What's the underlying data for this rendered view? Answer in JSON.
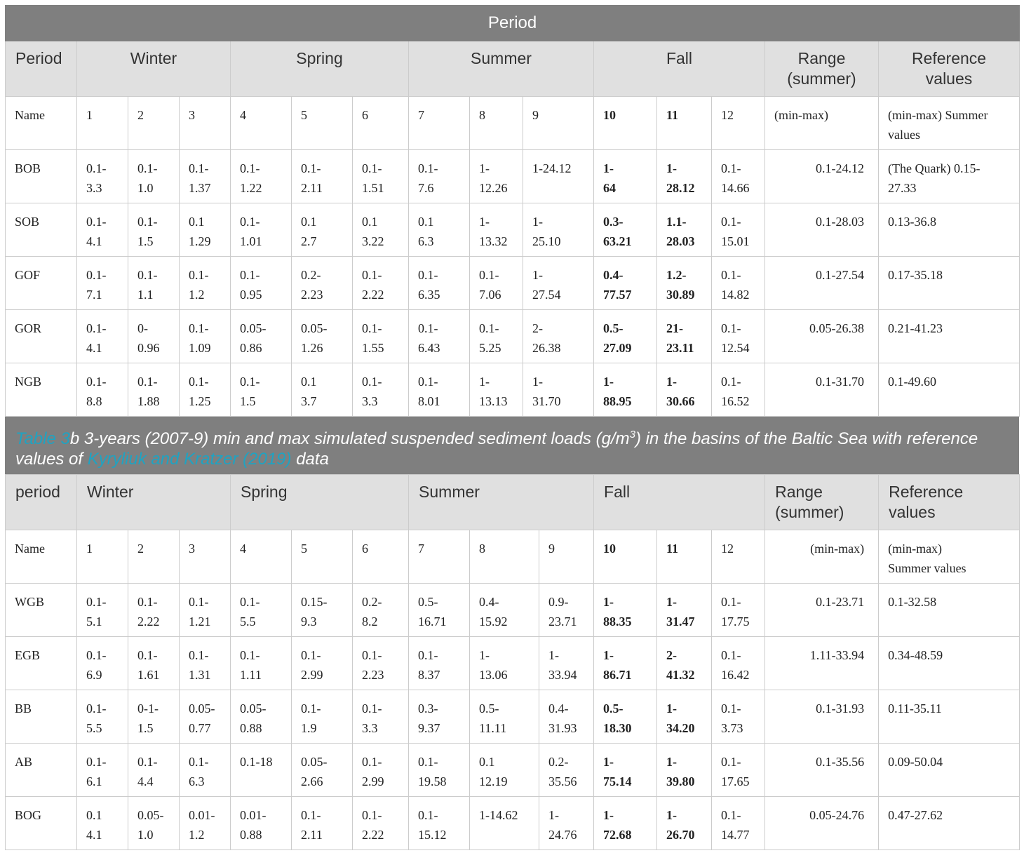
{
  "title_bar": "Period",
  "caption": {
    "part1": "Table 3",
    "part2": "b 3-years (2007-9) min and max simulated suspended sediment loads (g/m",
    "sup": "3",
    "part3": ") in the basins of the Baltic Sea with reference values of ",
    "link": "Kyryliuk and Kratzer (2019)",
    "part4": " data"
  },
  "table1": {
    "headers": [
      "Period",
      "Winter",
      "Spring",
      "Summer",
      "Fall",
      "Range\n(summer)",
      "Reference\nvalues"
    ],
    "name_row": [
      "Name",
      "1",
      "2",
      "3",
      "4",
      "5",
      "6",
      "7",
      "8",
      "9",
      "10",
      "11",
      "12",
      "(min-max)",
      "(min-max) Summer values"
    ],
    "rows": [
      [
        "BOB",
        "0.1-\n3.3",
        "0.1-\n1.0",
        "0.1-\n1.37",
        "0.1-\n1.22",
        "0.1-\n2.11",
        "0.1-\n1.51",
        "0.1-\n7.6",
        "1-\n12.26",
        "1-24.12",
        "1-\n64",
        "1-\n28.12",
        "0.1-\n14.66",
        "0.1-24.12",
        "(The Quark) 0.15-\n27.33"
      ],
      [
        "SOB",
        "0.1-\n4.1",
        "0.1-\n1.5",
        "0.1\n1.29",
        "0.1-\n1.01",
        "0.1\n2.7",
        "0.1\n3.22",
        "0.1\n6.3",
        "1-\n13.32",
        "1-\n25.10",
        "0.3-\n63.21",
        "1.1-\n28.03",
        "0.1-\n15.01",
        "0.1-28.03",
        "0.13-36.8"
      ],
      [
        "GOF",
        "0.1-\n7.1",
        "0.1-\n1.1",
        "0.1-\n1.2",
        "0.1-\n0.95",
        "0.2-\n2.23",
        "0.1-\n2.22",
        "0.1-\n6.35",
        "0.1-\n7.06",
        "1-\n27.54",
        "0.4-\n77.57",
        "1.2-\n30.89",
        "0.1-\n14.82",
        "0.1-27.54",
        "0.17-35.18"
      ],
      [
        "GOR",
        "0.1-\n4.1",
        "0-\n0.96",
        "0.1-\n1.09",
        "0.05-\n0.86",
        "0.05-\n1.26",
        "0.1-\n1.55",
        "0.1-\n6.43",
        "0.1-\n5.25",
        "2-\n26.38",
        "0.5-\n27.09",
        "21-\n23.11",
        "0.1-\n12.54",
        "0.05-26.38",
        "0.21-41.23"
      ],
      [
        "NGB",
        "0.1-\n8.8",
        "0.1-\n1.88",
        "0.1-\n1.25",
        "0.1-\n1.5",
        "0.1\n3.7",
        "0.1-\n3.3",
        "0.1-\n8.01",
        "1-\n13.13",
        "1-\n31.70",
        "1-\n88.95",
        "1-\n30.66",
        "0.1-\n16.52",
        "0.1-31.70",
        "0.1-49.60"
      ]
    ]
  },
  "table2": {
    "headers": [
      "period",
      "Winter",
      "Spring",
      "Summer",
      "Fall",
      "Range\n(summer)",
      "Reference\nvalues"
    ],
    "name_row": [
      "Name",
      "1",
      "2",
      "3",
      "4",
      "5",
      "6",
      "7",
      "8",
      "9",
      "10",
      "11",
      "12",
      "(min-max)",
      "(min-max)\nSummer values"
    ],
    "rows": [
      [
        "WGB",
        "0.1-\n5.1",
        "0.1-\n2.22",
        "0.1-\n1.21",
        "0.1-\n5.5",
        "0.15-\n9.3",
        "0.2-\n8.2",
        "0.5-\n16.71",
        "0.4-\n15.92",
        "0.9-\n23.71",
        "1-\n88.35",
        "1-\n31.47",
        "0.1-\n17.75",
        "0.1-23.71",
        "0.1-32.58"
      ],
      [
        "EGB",
        "0.1-\n6.9",
        "0.1-\n1.61",
        "0.1-\n1.31",
        "0.1-\n1.11",
        "0.1-\n2.99",
        "0.1-\n2.23",
        "0.1-\n8.37",
        "1-\n13.06",
        "1-\n33.94",
        "1-\n86.71",
        "2-\n41.32",
        "0.1-\n16.42",
        "1.11-33.94",
        "0.34-48.59"
      ],
      [
        "BB",
        "0.1-\n5.5",
        "0-1-\n1.5",
        "0.05-\n0.77",
        "0.05-\n0.88",
        "0.1-\n1.9",
        "0.1-\n3.3",
        "0.3-\n9.37",
        "0.5-\n11.11",
        "0.4-\n31.93",
        "0.5-\n18.30",
        "1-\n34.20",
        "0.1-\n3.73",
        "0.1-31.93",
        "0.11-35.11"
      ],
      [
        "AB",
        "0.1-\n6.1",
        "0.1-\n4.4",
        "0.1-\n6.3",
        "0.1-18",
        "0.05-\n2.66",
        "0.1-\n2.99",
        "0.1-\n19.58",
        "0.1\n12.19",
        "0.2-\n35.56",
        "1-\n75.14",
        "1-\n39.80",
        "0.1-\n17.65",
        "0.1-35.56",
        "0.09-50.04"
      ],
      [
        "BOG",
        "0.1\n4.1",
        "0.05-\n1.0",
        "0.01-\n1.2",
        "0.01-\n0.88",
        "0.1-\n2.11",
        "0.1-\n2.22",
        "0.1-\n15.12",
        "1-14.62",
        "1-\n24.76",
        "1-\n72.68",
        "1-\n26.70",
        "0.1-\n14.77",
        "0.05-24.76",
        "0.47-27.62"
      ]
    ]
  }
}
